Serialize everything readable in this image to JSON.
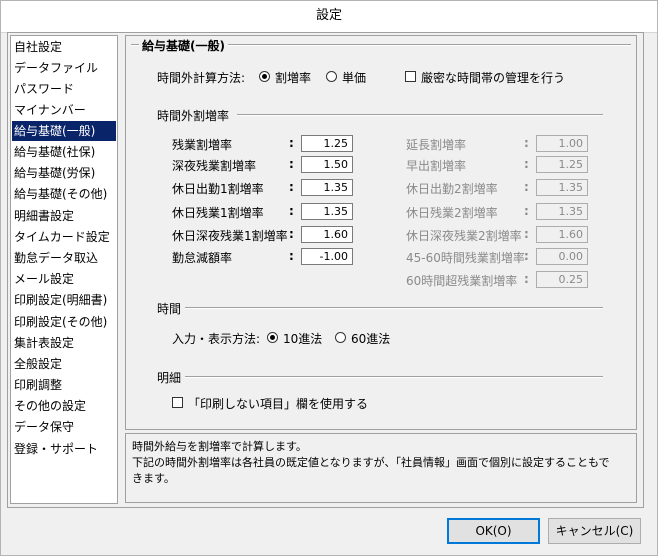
{
  "window": {
    "title": "設定"
  },
  "sidebar": {
    "items": [
      {
        "label": "自社設定"
      },
      {
        "label": "データファイル"
      },
      {
        "label": "パスワード"
      },
      {
        "label": "マイナンバー"
      },
      {
        "label": "給与基礎(一般)",
        "selected": true
      },
      {
        "label": "給与基礎(社保)"
      },
      {
        "label": "給与基礎(労保)"
      },
      {
        "label": "給与基礎(その他)"
      },
      {
        "label": "明細書設定"
      },
      {
        "label": "タイムカード設定"
      },
      {
        "label": "勤怠データ取込"
      },
      {
        "label": "メール設定"
      },
      {
        "label": "印刷設定(明細書)"
      },
      {
        "label": "印刷設定(その他)"
      },
      {
        "label": "集計表設定"
      },
      {
        "label": "全般設定"
      },
      {
        "label": "印刷調整"
      },
      {
        "label": "その他の設定"
      },
      {
        "label": "データ保守"
      },
      {
        "label": "登録・サポート"
      }
    ]
  },
  "panel": {
    "title": "給与基礎(一般)",
    "calc_method": {
      "label": "時間外計算方法:",
      "options": [
        "割増率",
        "単価"
      ],
      "selected": "割増率"
    },
    "strict_time": {
      "label": "厳密な時間帯の管理を行う",
      "checked": false
    },
    "overtime_section": {
      "title": "時間外割増率"
    },
    "left_rates": [
      {
        "label": "残業割増率",
        "value": "1.25"
      },
      {
        "label": "深夜残業割増率",
        "value": "1.50"
      },
      {
        "label": "休日出勤1割増率",
        "value": "1.35"
      },
      {
        "label": "休日残業1割増率",
        "value": "1.35"
      },
      {
        "label": "休日深夜残業1割増率",
        "value": "1.60"
      },
      {
        "label": "勤怠減額率",
        "value": "-1.00"
      }
    ],
    "right_rates": [
      {
        "label": "延長割増率",
        "value": "1.00"
      },
      {
        "label": "早出割増率",
        "value": "1.25"
      },
      {
        "label": "休日出勤2割増率",
        "value": "1.35"
      },
      {
        "label": "休日残業2割増率",
        "value": "1.35"
      },
      {
        "label": "休日深夜残業2割増率",
        "value": "1.60"
      },
      {
        "label": "45-60時間残業割増率",
        "value": "0.00"
      },
      {
        "label": "60時間超残業割増率",
        "value": "0.25"
      }
    ],
    "colon": ":",
    "time_section": {
      "title": "時間",
      "label": "入力・表示方法:",
      "options": [
        "10進法",
        "60進法"
      ],
      "selected": "10進法"
    },
    "detail_section": {
      "title": "明細",
      "checkbox_label": "「印刷しない項目」欄を使用する",
      "checked": false
    }
  },
  "description": {
    "line1": "時間外給与を割増率で計算します。",
    "line2": "下記の時間外割増率は各社員の既定値となりますが、「社員情報」画面で個別に設定することもで",
    "line3": "きます。"
  },
  "buttons": {
    "ok": "OK(O)",
    "cancel": "キャンセル(C)"
  }
}
